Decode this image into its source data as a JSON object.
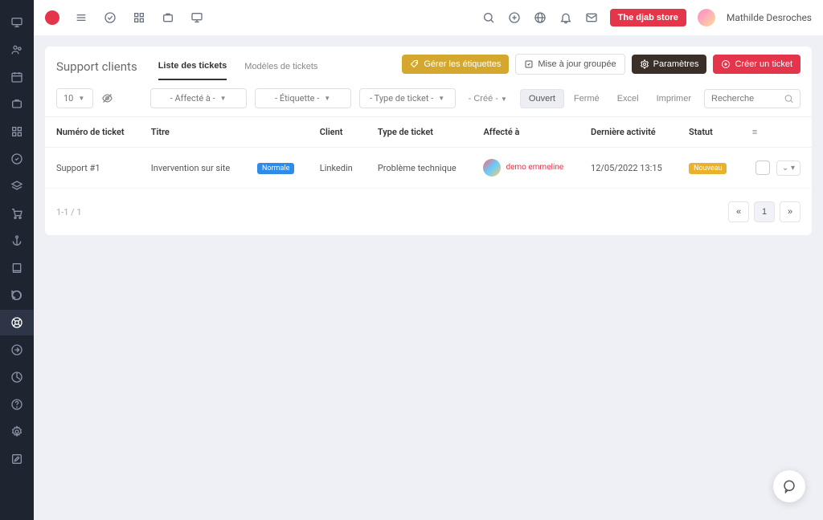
{
  "topbar": {
    "store_badge": "The djab store",
    "username": "Mathilde Desroches"
  },
  "page": {
    "title": "Support clients",
    "tabs": [
      {
        "label": "Liste des tickets",
        "active": true
      },
      {
        "label": "Modèles de tickets",
        "active": false
      }
    ],
    "actions": {
      "manage_labels": "Gérer les étiquettes",
      "bulk_update": "Mise à jour groupée",
      "settings": "Paramètres",
      "create": "Créer un ticket"
    }
  },
  "filters": {
    "page_size": "10",
    "assigned": "- Affecté à -",
    "label": "- Étiquette -",
    "ticket_type": "- Type de ticket -",
    "created": "- Créé -",
    "status_open": "Ouvert",
    "status_closed": "Fermé",
    "export_excel": "Excel",
    "print": "Imprimer",
    "search_placeholder": "Recherche"
  },
  "table": {
    "columns": {
      "ticket_no": "Numéro de ticket",
      "title": "Titre",
      "client": "Client",
      "type": "Type de ticket",
      "assigned": "Affecté à",
      "activity": "Dernière activité",
      "status": "Statut"
    },
    "rows": [
      {
        "ticket_no": "Support #1",
        "title": "Invervention sur site",
        "priority": "Normale",
        "client": "Linkedin",
        "type": "Problème technique",
        "assigned": "demo emmeline",
        "activity": "12/05/2022 13:15",
        "status": "Nouveau"
      }
    ]
  },
  "paging": {
    "info": "1-1 / 1",
    "current": "1"
  }
}
